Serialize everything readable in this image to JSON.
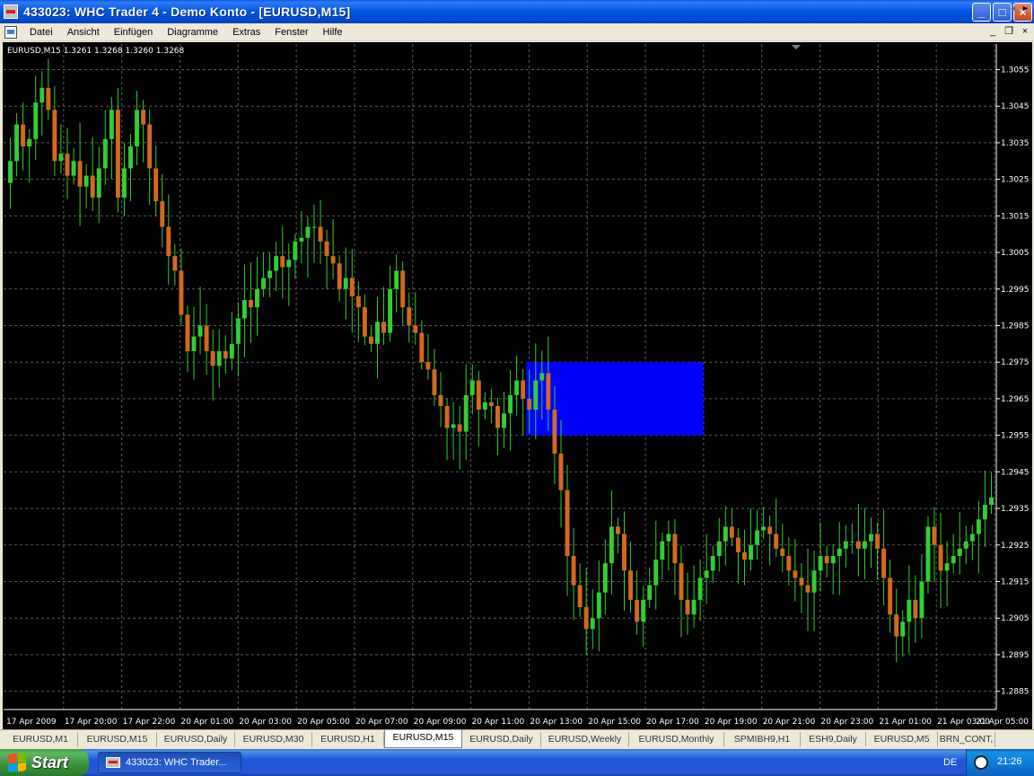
{
  "window": {
    "title": "433023: WHC Trader 4 - Demo Konto - [EURUSD,M15]",
    "buttons": {
      "minimize": "_",
      "maximize": "□",
      "close": "×"
    }
  },
  "menu": {
    "items": [
      "Datei",
      "Ansicht",
      "Einfügen",
      "Diagramme",
      "Extras",
      "Fenster",
      "Hilfe"
    ],
    "mdi": {
      "minimize": "_",
      "restore": "❐",
      "close": "×"
    }
  },
  "chart_info": {
    "symbol_line": "EURUSD,M15  1.3261 1.3268 1.3260 1.3268"
  },
  "colors": {
    "background": "#000000",
    "grid": "#5a5a5a",
    "bull": "#32cd32",
    "bear": "#d2691e",
    "wick": "#32cd32",
    "rectangle": "#0000ff",
    "axis_text": "#ffffff"
  },
  "chart_data": {
    "type": "candlestick",
    "symbol": "EURUSD",
    "timeframe": "M15",
    "ylim": [
      1.288,
      1.3062
    ],
    "grid": true,
    "price_labels": [
      "1.3055",
      "1.3045",
      "1.3035",
      "1.3025",
      "1.3015",
      "1.3005",
      "1.2995",
      "1.2985",
      "1.2975",
      "1.2965",
      "1.2955",
      "1.2945",
      "1.2935",
      "1.2925",
      "1.2915",
      "1.2905",
      "1.2895",
      "1.2885"
    ],
    "time_labels": [
      "17 Apr 2009",
      "17 Apr 20:00",
      "17 Apr 22:00",
      "20 Apr 01:00",
      "20 Apr 03:00",
      "20 Apr 05:00",
      "20 Apr 07:00",
      "20 Apr 09:00",
      "20 Apr 11:00",
      "20 Apr 13:00",
      "20 Apr 15:00",
      "20 Apr 17:00",
      "20 Apr 19:00",
      "20 Apr 21:00",
      "20 Apr 23:00",
      "21 Apr 01:00",
      "21 Apr 03:00",
      "21 Apr 05:00"
    ],
    "highlight_zone": {
      "price_high": 1.2975,
      "price_low": 1.2955,
      "from_bar": 82,
      "to_bar": 110
    },
    "ohlc_path": [
      1.303,
      1.304,
      1.3034,
      1.3036,
      1.3046,
      1.305,
      1.3044,
      1.303,
      1.3032,
      1.3026,
      1.303,
      1.3023,
      1.3026,
      1.302,
      1.3028,
      1.3036,
      1.3044,
      1.302,
      1.3028,
      1.3034,
      1.3044,
      1.304,
      1.3028,
      1.3019,
      1.3012,
      1.3004,
      1.3,
      1.2988,
      1.2978,
      1.2982,
      1.2985,
      1.2978,
      1.2974,
      1.2978,
      1.2976,
      1.298,
      1.2987,
      1.2992,
      1.299,
      1.2995,
      1.2998,
      1.3,
      1.3004,
      1.3001,
      1.3003,
      1.3008,
      1.3009,
      1.3012,
      1.3012,
      1.3008,
      1.3004,
      1.3002,
      1.2995,
      1.2998,
      1.2993,
      1.299,
      1.2982,
      1.298,
      1.2986,
      1.2983,
      1.2995,
      1.3,
      1.299,
      1.2985,
      1.2983,
      1.2975,
      1.2973,
      1.2966,
      1.2963,
      1.2957,
      1.2958,
      1.2956,
      1.2966,
      1.297,
      1.2962,
      1.2964,
      1.2963,
      1.2957,
      1.2961,
      1.2966,
      1.297,
      1.2965,
      1.2962,
      1.297,
      1.2972,
      1.2962,
      1.295,
      1.294,
      1.2922,
      1.2914,
      1.2908,
      1.2902,
      1.2905,
      1.2912,
      1.292,
      1.293,
      1.2928,
      1.2918,
      1.291,
      1.2904,
      1.291,
      1.2914,
      1.2921,
      1.2926,
      1.2928,
      1.292,
      1.291,
      1.2906,
      1.291,
      1.2916,
      1.2918,
      1.2922,
      1.2926,
      1.293,
      1.2927,
      1.2923,
      1.2921,
      1.2925,
      1.2929,
      1.293,
      1.2928,
      1.2924,
      1.2922,
      1.2918,
      1.2916,
      1.2914,
      1.2912,
      1.2918,
      1.2922,
      1.292,
      1.2922,
      1.2924,
      1.2926,
      1.2926,
      1.2924,
      1.2926,
      1.2928,
      1.2924,
      1.2916,
      1.2906,
      1.29,
      1.2904,
      1.291,
      1.2905,
      1.2915,
      1.293,
      1.2925,
      1.2918,
      1.292,
      1.2922,
      1.2924,
      1.2926,
      1.2928,
      1.2932,
      1.2936,
      1.2938
    ]
  },
  "tabs": {
    "items": [
      "EURUSD,M1",
      "EURUSD,M15",
      "EURUSD,Daily",
      "EURUSD,M30",
      "EURUSD,H1",
      "EURUSD,M15",
      "EURUSD,Daily",
      "EURUSD,Weekly",
      "EURUSD,Monthly",
      "SPMIBH9,H1",
      "ESH9,Daily",
      "EURUSD,M5",
      "BRN_CONT,"
    ],
    "active_index": 5,
    "scroll_left": "◄",
    "scroll_right": "►"
  },
  "taskbar": {
    "start_label": "Start",
    "task_label": "433023: WHC Trader...",
    "language": "DE",
    "clock": "21:26"
  }
}
